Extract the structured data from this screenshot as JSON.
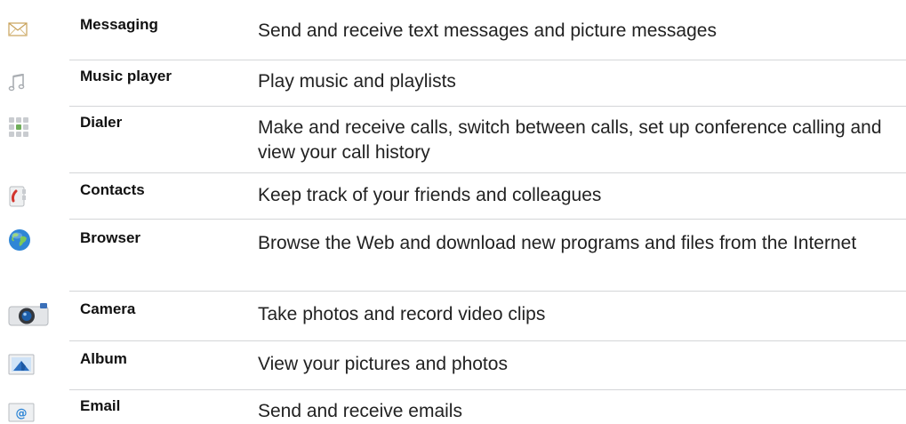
{
  "rows": [
    {
      "icon": "envelope-icon",
      "name": "Messaging",
      "description": "Send and receive text messages and picture messages"
    },
    {
      "icon": "music-note-icon",
      "name": "Music player",
      "description": "Play music and playlists"
    },
    {
      "icon": "keypad-icon",
      "name": "Dialer",
      "description": "Make and receive calls, switch between calls, set up conference calling and view your call history"
    },
    {
      "icon": "phonebook-icon",
      "name": "Contacts",
      "description": "Keep track of your friends and colleagues"
    },
    {
      "icon": "globe-icon",
      "name": "Browser",
      "description": "Browse the Web and download new programs and files from the Internet"
    },
    {
      "icon": "camera-icon",
      "name": "Camera",
      "description": "Take photos and record video clips"
    },
    {
      "icon": "photo-album-icon",
      "name": "Album",
      "description": "View your pictures and photos"
    },
    {
      "icon": "at-sign-icon",
      "name": "Email",
      "description": "Send and receive emails"
    }
  ]
}
